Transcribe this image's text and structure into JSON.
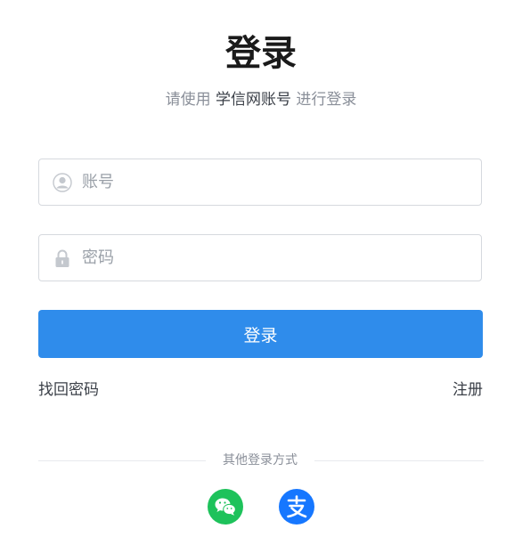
{
  "page": {
    "title": "登录",
    "subtitle_prefix": "请使用 ",
    "subtitle_account": "学信网账号",
    "subtitle_suffix": " 进行登录"
  },
  "form": {
    "account_placeholder": "账号",
    "password_placeholder": "密码",
    "account_value": "",
    "password_value": "",
    "submit_label": "登录"
  },
  "links": {
    "forgot_password": "找回密码",
    "register": "注册"
  },
  "other_login": {
    "label": "其他登录方式",
    "methods": [
      {
        "icon": "wechat-icon",
        "color": "#1ec25b"
      },
      {
        "icon": "alipay-icon",
        "color": "#1677ff"
      }
    ]
  },
  "colors": {
    "primary": "#2f8ceb",
    "wechat": "#1ec25b",
    "alipay": "#1677ff"
  }
}
